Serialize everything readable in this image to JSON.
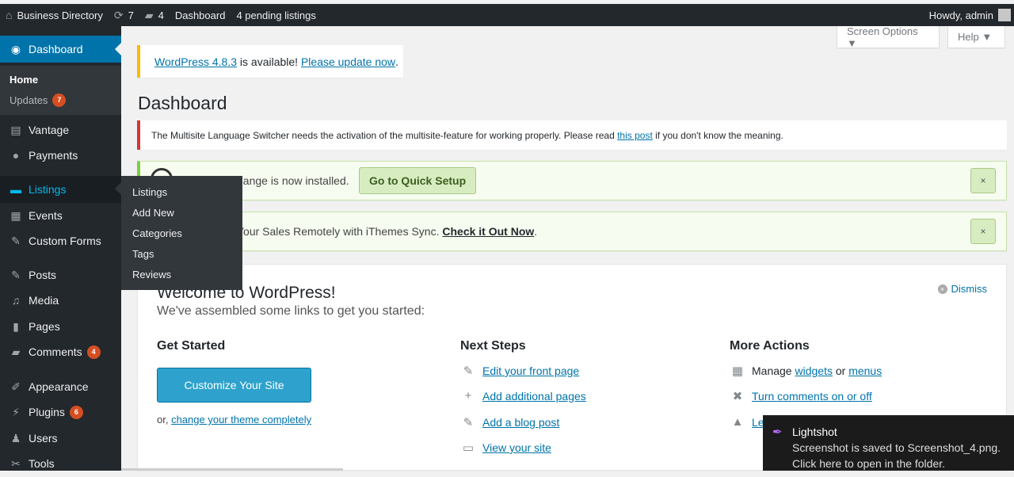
{
  "adminbar": {
    "site_name": "Business Directory",
    "updates_count": "7",
    "comments_count": "4",
    "dashboard": "Dashboard",
    "pending": "4 pending listings",
    "howdy": "Howdy, admin"
  },
  "sidebar": {
    "dashboard": "Dashboard",
    "home": "Home",
    "updates": "Updates",
    "updates_badge": "7",
    "vantage": "Vantage",
    "payments": "Payments",
    "listings": "Listings",
    "events": "Events",
    "custom_forms": "Custom Forms",
    "posts": "Posts",
    "media": "Media",
    "pages": "Pages",
    "comments": "Comments",
    "comments_badge": "4",
    "appearance": "Appearance",
    "plugins": "Plugins",
    "plugins_badge": "6",
    "users": "Users",
    "tools": "Tools"
  },
  "flyout": [
    "Listings",
    "Add New",
    "Categories",
    "Tags",
    "Reviews"
  ],
  "screen_options": "Screen Options ▼",
  "help": "Help ▼",
  "update_nag": {
    "version_link": "WordPress 4.8.3",
    "middle": " is available! ",
    "update_link": "Please update now",
    "end": "."
  },
  "page_title": "Dashboard",
  "msls_notice": {
    "text": "The Multisite Language Switcher needs the activation of the multisite-feature for working properly. Please read ",
    "link": "this post",
    "after": " if you don't know the meaning."
  },
  "setup_notice": {
    "text": "hange is now installed.",
    "button": "Go to Quick Setup",
    "close": "×"
  },
  "sync_notice": {
    "text": "Your Sales Remotely with iThemes Sync. ",
    "link": "Check it Out Now",
    "after": ".",
    "close": "×"
  },
  "welcome": {
    "title": "Welcome to WordPress!",
    "about": "We've assembled some links to get you started:",
    "dismiss": "Dismiss",
    "get_started": "Get Started",
    "customize": "Customize Your Site",
    "or": "or, ",
    "change_theme": "change your theme completely",
    "next_steps": "Next Steps",
    "steps": [
      "Edit your front page",
      "Add additional pages",
      "Add a blog post",
      "View your site"
    ],
    "more_actions": "More Actions",
    "manage": "Manage ",
    "widgets": "widgets",
    "or2": " or ",
    "menus": "menus",
    "comments_toggle": "Turn comments on or off",
    "learn": "Le"
  },
  "lightshot": {
    "title": "Lightshot",
    "line1": "Screenshot is saved to Screenshot_4.png.",
    "line2": "Click here to open in the folder."
  }
}
